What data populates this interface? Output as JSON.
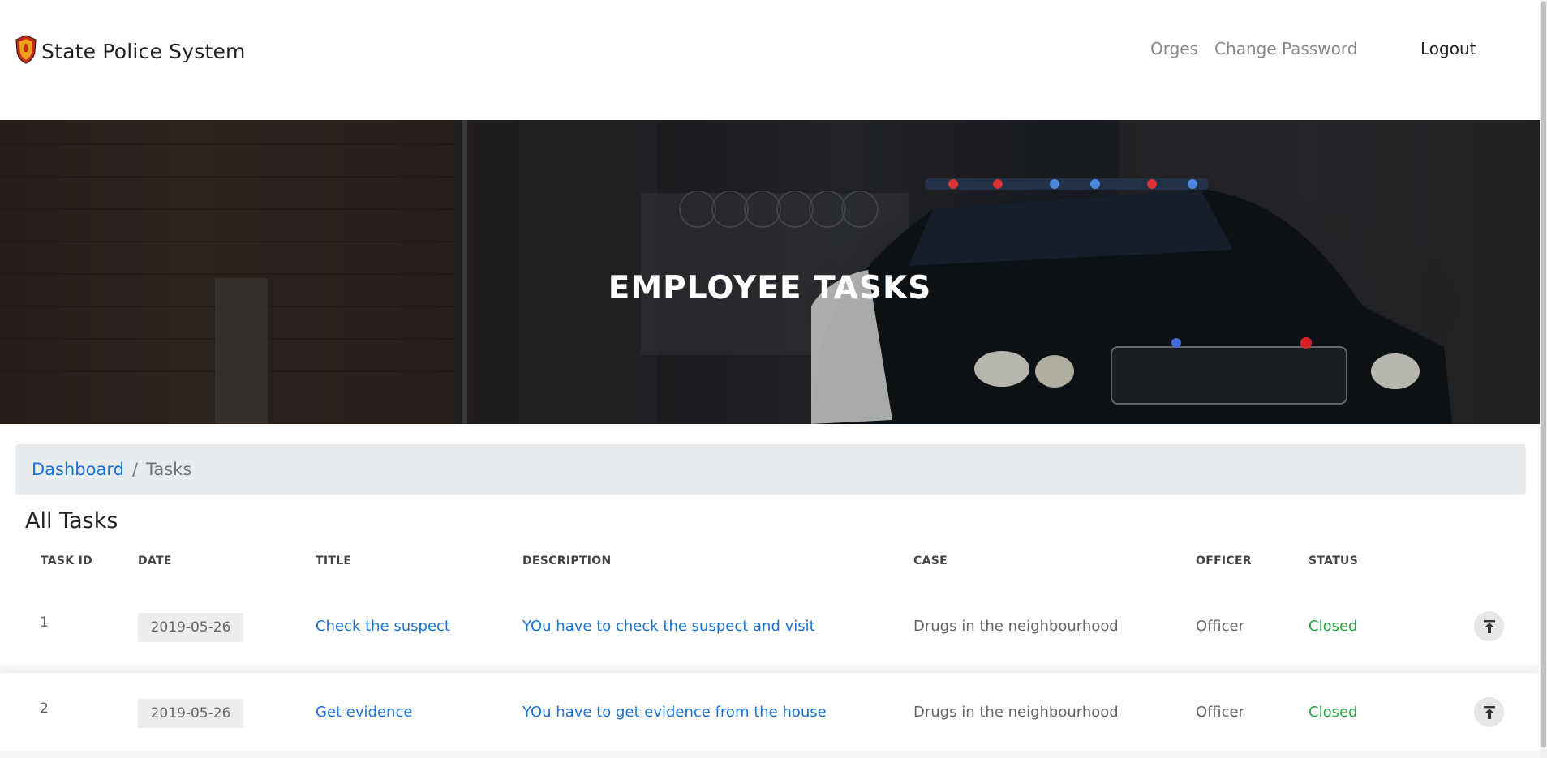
{
  "navbar": {
    "brand": "State Police System",
    "links": [
      "Orges",
      "Change Password"
    ],
    "logout": "Logout"
  },
  "hero": {
    "title": "EMPLOYEE TASKS"
  },
  "breadcrumb": {
    "home": "Dashboard",
    "separator": "/",
    "current": "Tasks"
  },
  "section": {
    "title": "All Tasks"
  },
  "table": {
    "headers": [
      "TASK ID",
      "DATE",
      "TITLE",
      "DESCRIPTION",
      "CASE",
      "OFFICER",
      "STATUS"
    ],
    "rows": [
      {
        "id": "1",
        "date": "2019-05-26",
        "title": "Check the suspect",
        "description": "YOu have to check the suspect and visit",
        "case": "Drugs in the neighbourhood",
        "officer": "Officer",
        "status": "Closed"
      },
      {
        "id": "2",
        "date": "2019-05-26",
        "title": "Get evidence",
        "description": "YOu have to get evidence from the house",
        "case": "Drugs in the neighbourhood",
        "officer": "Officer",
        "status": "Closed"
      }
    ]
  },
  "colors": {
    "link": "#1a73d9",
    "status_closed": "#28a745",
    "breadcrumb_bg": "#e9ecef"
  },
  "icons": {
    "brand": "police-shield-icon",
    "row_action": "move-to-top-icon"
  }
}
